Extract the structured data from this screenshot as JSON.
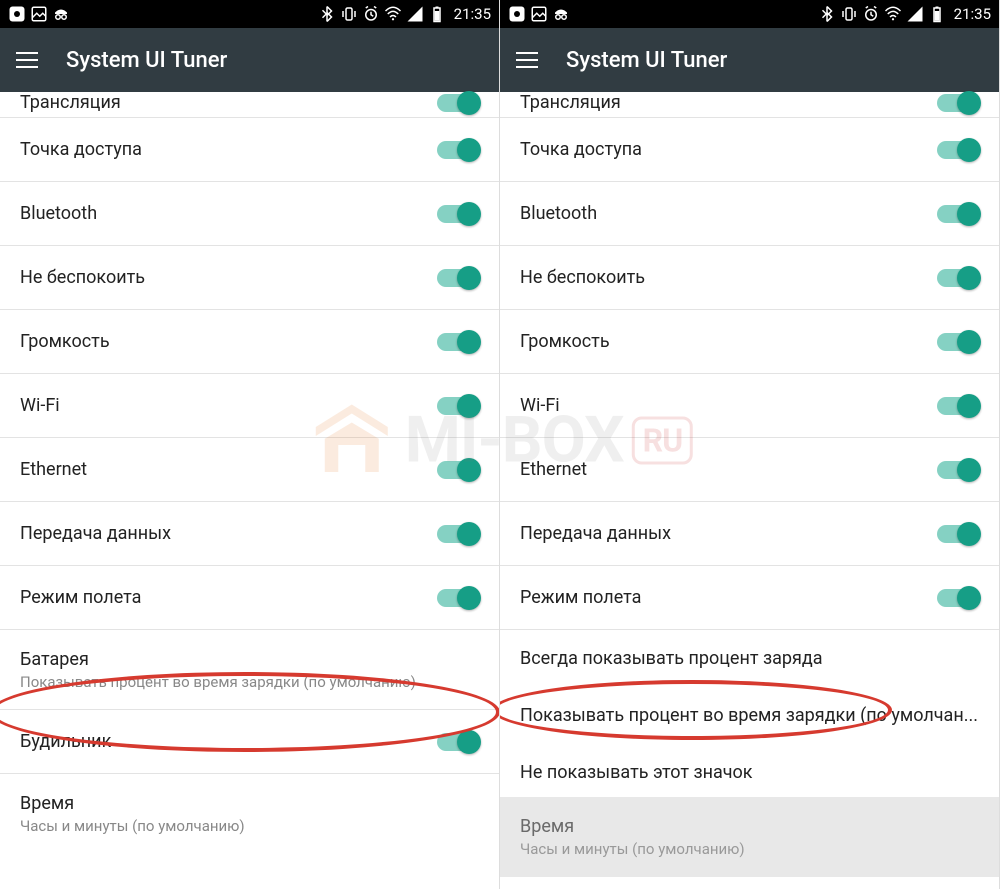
{
  "status_bar": {
    "time": "21:35",
    "icons_left": [
      "app1-icon",
      "image-icon",
      "incognito-icon"
    ],
    "icons_right": [
      "bluetooth-icon",
      "vibrate-icon",
      "alarm-icon",
      "wifi-icon",
      "signal-icon",
      "battery-icon"
    ]
  },
  "app_bar": {
    "title": "System UI Tuner"
  },
  "left_screen": {
    "rows": [
      {
        "label": "Трансляция",
        "switch": true,
        "cut": true
      },
      {
        "label": "Точка доступа",
        "switch": true
      },
      {
        "label": "Bluetooth",
        "switch": true
      },
      {
        "label": "Не беспокоить",
        "switch": true
      },
      {
        "label": "Громкость",
        "switch": true
      },
      {
        "label": "Wi-Fi",
        "switch": true
      },
      {
        "label": "Ethernet",
        "switch": true
      },
      {
        "label": "Передача данных",
        "switch": true
      },
      {
        "label": "Режим полета",
        "switch": true
      },
      {
        "label": "Батарея",
        "sublabel": "Показывать процент во время зарядки (по умолчанию)"
      },
      {
        "label": "Будильник",
        "switch": true
      },
      {
        "label": "Время",
        "sublabel": "Часы и минуты (по умолчанию)"
      }
    ]
  },
  "right_screen": {
    "rows": [
      {
        "label": "Трансляция",
        "switch": true,
        "cut": true
      },
      {
        "label": "Точка доступа",
        "switch": true
      },
      {
        "label": "Bluetooth",
        "switch": true
      },
      {
        "label": "Не беспокоить",
        "switch": true
      },
      {
        "label": "Громкость",
        "switch": true
      },
      {
        "label": "Wi-Fi",
        "switch": true
      },
      {
        "label": "Ethernet",
        "switch": true
      },
      {
        "label": "Передача данных",
        "switch": true
      },
      {
        "label": "Режим полета",
        "switch": true
      }
    ],
    "popup": {
      "options": [
        "Всегда показывать процент заряда",
        "Показывать процент во время зарядки (по умолчан...",
        "Не показывать этот значок"
      ]
    },
    "dimmed": {
      "label": "Время",
      "sublabel": "Часы и минуты (по умолчанию)"
    }
  },
  "watermark": {
    "text": "MI-BOX",
    "suffix": "RU"
  }
}
